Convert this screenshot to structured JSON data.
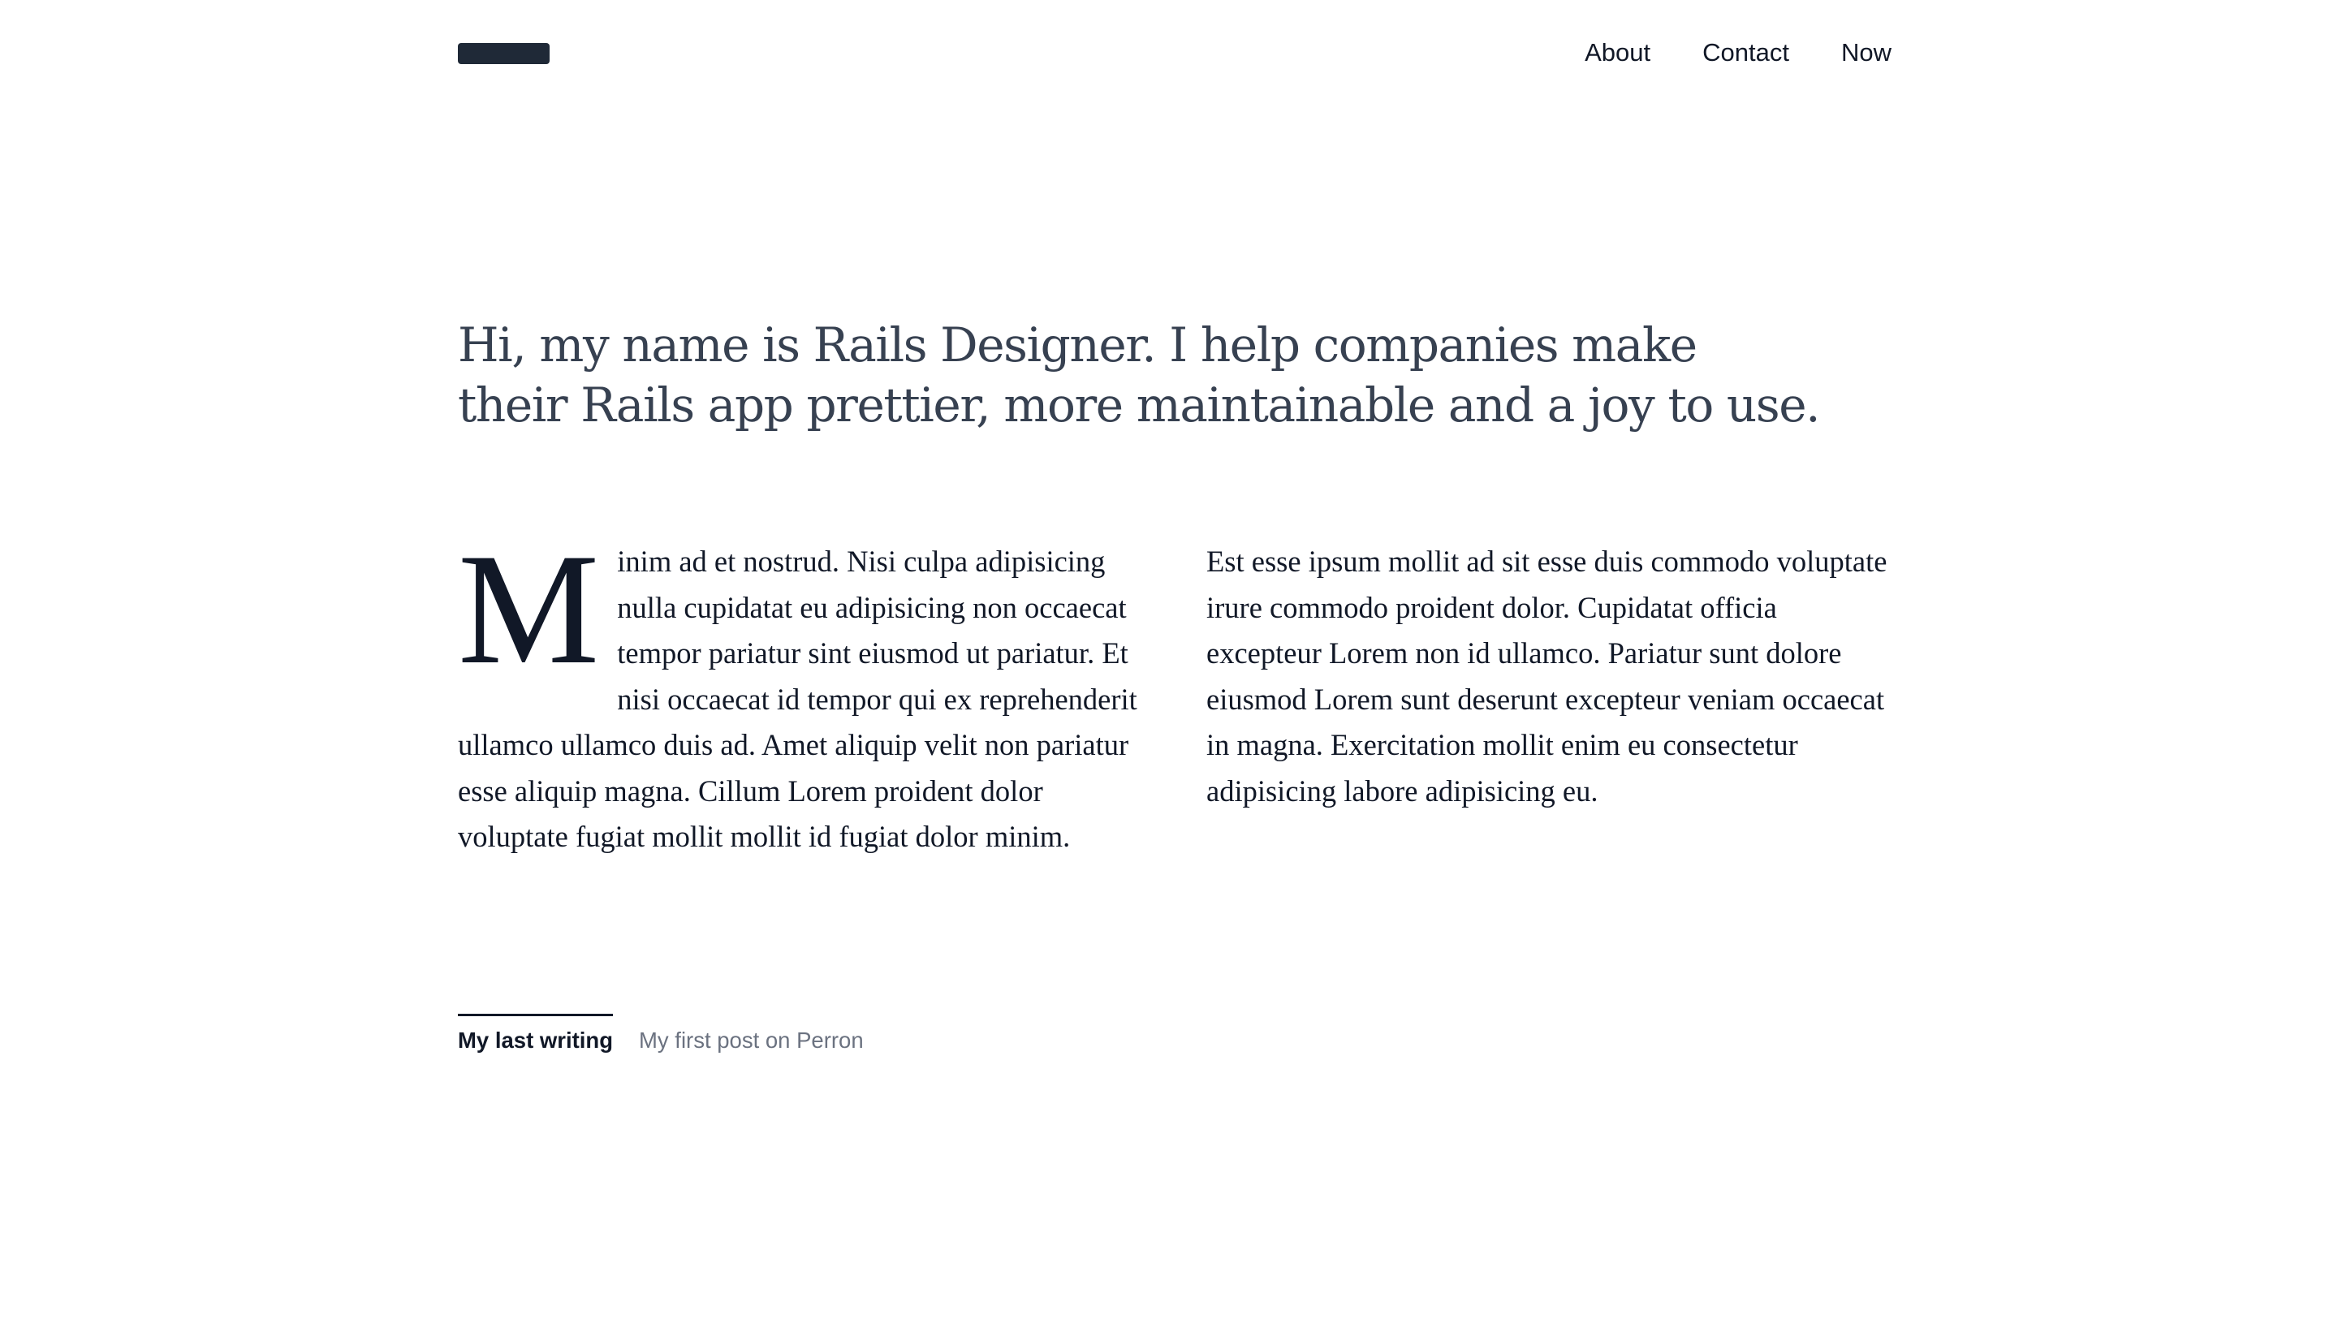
{
  "header": {
    "nav": [
      "About",
      "Contact",
      "Now"
    ]
  },
  "intro": {
    "line1": "Hi, my name is Rails Designer. I help companies make",
    "line2": "their Rails app prettier, more maintainable and a joy to use."
  },
  "body": {
    "dropcap": "M",
    "col1_rest": "inim ad et nostrud. Nisi culpa adipisicing nulla cupidatat eu adipisicing non occaecat tempor pariatur sint eiusmod ut pariatur. Et nisi occaecat id tempor qui ex reprehenderit ullamco ullamco duis ad. Amet aliquip velit non pariatur esse aliquip magna. Cillum Lorem proident dolor voluptate fugiat mollit mollit id fugiat dolor minim.",
    "col2": "Est esse ipsum mollit ad sit esse duis commodo voluptate irure commodo proident dolor. Cupidatat officia excepteur Lorem non id ullamco. Pariatur sunt dolore eiusmod Lorem sunt deserunt excepteur veniam occaecat in magna. Exercitation mollit enim eu consectetur adipisicing labore adipisicing eu."
  },
  "writing": {
    "label": "My last writing",
    "post_title": "My first post on Perron"
  }
}
